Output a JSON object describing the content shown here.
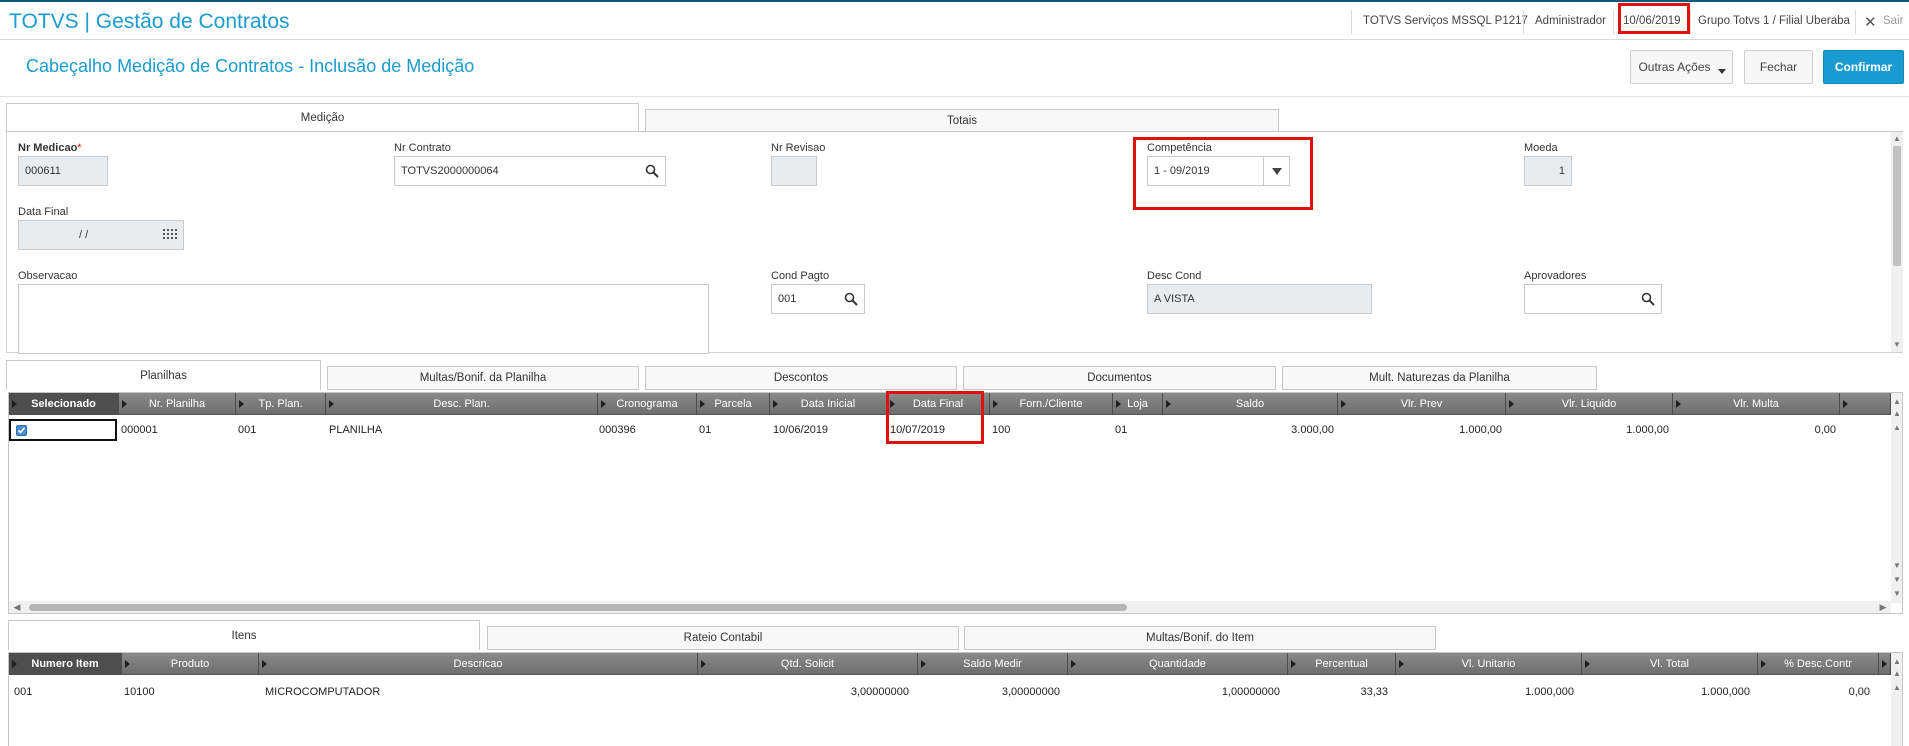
{
  "app": {
    "title": "TOTVS | Gestão de Contratos"
  },
  "topbar": {
    "environment": "TOTVS Serviços MSSQL P1217",
    "user": "Administrador",
    "date": "10/06/2019",
    "branch": "Grupo Totvs 1 / Filial Uberaba",
    "exit_label": "Sair"
  },
  "page": {
    "title": "Cabeçalho Medição de Contratos - Inclusão de Medição"
  },
  "actions": {
    "more_label": "Outras Ações",
    "close_label": "Fechar",
    "confirm_label": "Confirmar"
  },
  "main_tabs": [
    {
      "label": "Medição",
      "active": true
    },
    {
      "label": "Totais",
      "active": false
    }
  ],
  "form": {
    "nr_medicao": {
      "label": "Nr Medicao",
      "required_mark": "*",
      "value": "000611"
    },
    "nr_contrato": {
      "label": "Nr Contrato",
      "value": "TOTVS2000000064"
    },
    "nr_revisao": {
      "label": "Nr Revisao",
      "value": ""
    },
    "competencia": {
      "label": "Competência",
      "value": "1 - 09/2019"
    },
    "moeda": {
      "label": "Moeda",
      "value": "1"
    },
    "data_final": {
      "label": "Data Final",
      "value": "/ /"
    },
    "observacao": {
      "label": "Observacao",
      "value": ""
    },
    "cond_pagto": {
      "label": "Cond Pagto",
      "value": "001"
    },
    "desc_cond": {
      "label": "Desc Cond",
      "value": "A VISTA"
    },
    "aprovadores": {
      "label": "Aprovadores",
      "value": ""
    }
  },
  "sheet_tabs": [
    {
      "label": "Planilhas",
      "active": true
    },
    {
      "label": "Multas/Bonif. da Planilha",
      "active": false
    },
    {
      "label": "Descontos",
      "active": false
    },
    {
      "label": "Documentos",
      "active": false
    },
    {
      "label": "Mult. Naturezas da Planilha",
      "active": false
    }
  ],
  "sheets_grid": {
    "columns": [
      "Selecionado",
      "Nr. Planilha",
      "Tp. Plan.",
      "Desc. Plan.",
      "Cronograma",
      "Parcela",
      "Data Inicial",
      "Data Final",
      "Forn./Cliente",
      "Loja",
      "Saldo",
      "Vlr. Prev",
      "Vlr. Liquido",
      "Vlr. Multa"
    ],
    "rows": [
      {
        "selected": true,
        "nr_planilha": "000001",
        "tp_plan": "001",
        "desc_plan": "PLANILHA",
        "cronograma": "000396",
        "parcela": "01",
        "data_inicial": "10/06/2019",
        "data_final": "10/07/2019",
        "forn_cliente": "100",
        "loja": "01",
        "saldo": "3.000,00",
        "vlr_prev": "1.000,00",
        "vlr_liquido": "1.000,00",
        "vlr_multa": "0,00"
      }
    ]
  },
  "item_tabs": [
    {
      "label": "Itens",
      "active": true
    },
    {
      "label": "Rateio Contabil",
      "active": false
    },
    {
      "label": "Multas/Bonif. do Item",
      "active": false
    }
  ],
  "items_grid": {
    "columns": [
      "Numero Item",
      "Produto",
      "Descricao",
      "Qtd. Solicit",
      "Saldo Medir",
      "Quantidade",
      "Percentual",
      "Vl. Unitario",
      "Vl. Total",
      "% Desc.Contr"
    ],
    "rows": [
      {
        "numero_item": "001",
        "produto": "10100",
        "descricao": "MICROCOMPUTADOR",
        "qtd_solicit": "3,00000000",
        "saldo_medir": "3,00000000",
        "quantidade": "1,00000000",
        "percentual": "33,33",
        "vl_unitario": "1.000,000",
        "vl_total": "1.000,000",
        "desc_contr": "0,00"
      }
    ]
  },
  "colors": {
    "brand": "#1a9bd1",
    "confirm": "#1a9bd1",
    "highlight": "#e01010",
    "grid_header": "#7a7a7a"
  },
  "icons": [
    "search-icon",
    "calendar-icon",
    "dropdown-arrow-icon",
    "close-icon",
    "checkbox-icon"
  ]
}
